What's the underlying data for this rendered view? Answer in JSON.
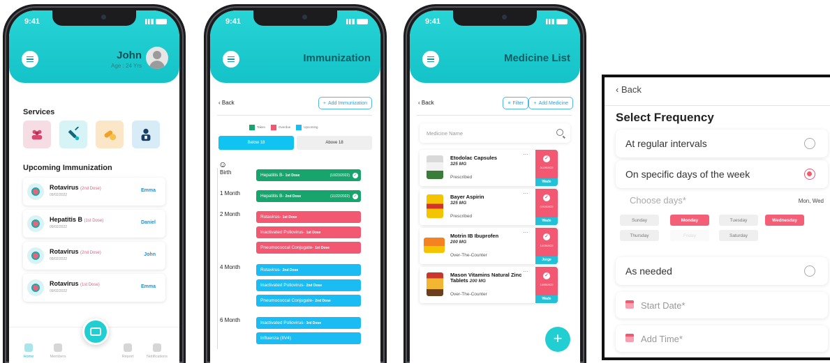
{
  "status_time": "9:41",
  "colors": {
    "accent": "#21cfd3",
    "taken": "#18a56d",
    "overdue": "#f25871",
    "upcoming": "#1abcf3",
    "link_blue": "#1f8fd0"
  },
  "home": {
    "user_name": "John",
    "user_age": "Age : 24 Yrs",
    "services_title": "Services",
    "services": [
      {
        "icon": "group-icon",
        "bg": "#f6dde3"
      },
      {
        "icon": "vaccine-icon",
        "bg": "#d6f3f6"
      },
      {
        "icon": "pills-icon",
        "bg": "#fbe7c8"
      },
      {
        "icon": "doctor-icon",
        "bg": "#d8ecf8"
      }
    ],
    "upcoming_title": "Upcoming Immunization",
    "immunizations": [
      {
        "name": "Rotavirus",
        "dose": "(2nd Dose)",
        "date": "09/02/2022",
        "person": "Emma"
      },
      {
        "name": "Hepatitis B",
        "dose": "(1st Dose)",
        "date": "09/02/2022",
        "person": "Daniel"
      },
      {
        "name": "Rotavirus",
        "dose": "(2nd Dose)",
        "date": "09/02/2022",
        "person": "John"
      },
      {
        "name": "Rotavirus",
        "dose": "(1st Dose)",
        "date": "09/02/2022",
        "person": "Emma"
      }
    ],
    "nav": [
      "Home",
      "Members",
      "Report",
      "Notifications"
    ]
  },
  "immunization": {
    "title": "Immunization",
    "back": "Back",
    "add_button": "Add Immunization",
    "legend": [
      "Taken",
      "Overdue",
      "Upcoming"
    ],
    "tabs": [
      "Below 18",
      "Above 18"
    ],
    "ages": [
      "Birth",
      "1 Month",
      "2 Month",
      "4 Month",
      "6 Month"
    ],
    "doses": [
      {
        "name": "Hepatitis B-",
        "dose": "1st Dose",
        "date": "(10/23/2022)"
      },
      {
        "name": "Hepatitis B-",
        "dose": "2nd Dose",
        "date": "(11/22/2022)"
      },
      {
        "name": "Rotavirus-",
        "dose": "1st Dose"
      },
      {
        "name": "Inactivated Poliovirus-",
        "dose": "1st Dose"
      },
      {
        "name": "Pneumococcal Conjugate-",
        "dose": "1st Dose"
      },
      {
        "name": "Rotavirus-",
        "dose": "2nd Dose"
      },
      {
        "name": "Inactivated Poliovirus-",
        "dose": "2nd Dose"
      },
      {
        "name": "Pneumococcal Conjugate-",
        "dose": "2nd Dose"
      },
      {
        "name": "Inactivated Poliovirus-",
        "dose": "3rd Dose"
      },
      {
        "name": "Influenza (IIV4)",
        "dose": ""
      }
    ]
  },
  "medicine": {
    "title": "Medicine List",
    "back": "Back",
    "filter": "Filter",
    "add_button": "Add Medicine",
    "search_placeholder": "Medicine Name",
    "items": [
      {
        "name": "Etodolac Capsules",
        "strength": "325 MG",
        "type": "Prescribed",
        "date": "01/29/2022",
        "person": "Wade"
      },
      {
        "name": "Bayer Aspirin",
        "strength": "325 MG",
        "type": "Prescribed",
        "date": "02/15/2022",
        "person": "Wade"
      },
      {
        "name": "Motrin IB Ibuprofen",
        "strength": "200 MG",
        "type": "Over-The-Counter",
        "date": "12/25/2022",
        "person": "Jorge"
      },
      {
        "name": "Mason Vitamins Natural Zinc Tablets",
        "strength": "200 MG",
        "type": "Over-The-Counter",
        "date": "13/05/2022",
        "person": "Wade"
      }
    ]
  },
  "frequency": {
    "back": "Back",
    "title": "Select Frequency",
    "options": [
      "At regular intervals",
      "On specific days of the week",
      "As needed"
    ],
    "choose_days": "Choose days*",
    "chosen_days": "Mon, Wed",
    "days": [
      "Sunday",
      "Monday",
      "Tuesday",
      "Wednesday",
      "Thursday",
      "Friday",
      "Saturday"
    ],
    "start_date": "Start Date*",
    "add_time": "Add Time*"
  }
}
